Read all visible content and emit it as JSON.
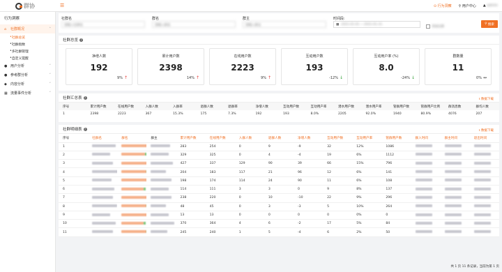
{
  "header": {
    "logo_text": "群协",
    "menu_icon": "hamburger-icon",
    "links": [
      "行为洞察",
      "用户中心"
    ],
    "user_name": "admin"
  },
  "sidebar": {
    "title": "行为洞察",
    "groups": [
      {
        "label": "社群概况",
        "icon": "home-icon",
        "active": true,
        "children": [
          {
            "label": "社群总览",
            "active": true
          },
          {
            "label": "社群指数",
            "active": false
          },
          {
            "label": "多社群管理",
            "active": false
          },
          {
            "label": "自定义提醒",
            "active": false
          }
        ]
      },
      {
        "label": "用户分析",
        "icon": "user-icon",
        "active": false
      },
      {
        "label": "参考群分析",
        "icon": "users-icon",
        "active": false
      },
      {
        "label": "内容分析",
        "icon": "content-icon",
        "active": false
      },
      {
        "label": "流量事件分析",
        "icon": "chart-icon",
        "active": false
      }
    ]
  },
  "filter": {
    "labels": [
      "社群名",
      "群名",
      "群主",
      "时间段:"
    ],
    "placeholders": [
      "请输入社群名",
      "请输入群名",
      "请输入群主",
      ""
    ],
    "date_value": "2021-01-01 ~ 2021-01-31",
    "checkbox_label": "添加比群",
    "search_label": "搜索"
  },
  "overview": {
    "title": "社群总览",
    "cards": [
      {
        "title": "净增人数",
        "value": "192",
        "change": "9%",
        "dir": "up"
      },
      {
        "title": "累计用户数",
        "value": "2398",
        "change": "14%",
        "dir": "up"
      },
      {
        "title": "在线用户数",
        "value": "2223",
        "change": "9%",
        "dir": "up"
      },
      {
        "title": "互动用户数",
        "value": "193",
        "change": "-12%",
        "dir": "down"
      },
      {
        "title": "互动用户率 (%)",
        "value": "8.0",
        "change": "-24%",
        "dir": "down"
      },
      {
        "title": "群数量",
        "value": "11",
        "change": "0%",
        "dir": "flat"
      }
    ]
  },
  "summary": {
    "title": "社群汇总表",
    "download": "数据下载",
    "headers": [
      "序号",
      "累计用户数",
      "在线用户数",
      "入群人数",
      "入群率",
      "退群人数",
      "退群率",
      "净增人数",
      "互动用户数",
      "互动用户率",
      "潜水用户数",
      "潜水用户率",
      "管群用户数",
      "管群用户比例",
      "群消息数",
      "群均人数"
    ],
    "row": [
      "1",
      "2398",
      "2223",
      "367",
      "15.3%",
      "175",
      "7.3%",
      "192",
      "193",
      "8.0%",
      "2205",
      "92.0%",
      "1940",
      "80.9%",
      "4076",
      "207"
    ]
  },
  "detail": {
    "title": "社群明细表",
    "download": "数据下载",
    "headers": [
      "序号",
      "社群名",
      "群名",
      "群主",
      "累计用户数",
      "在线用户数",
      "入群人数",
      "退群人数",
      "净增人数",
      "互动用户数",
      "互动用户率",
      "管群用户数",
      "群入时间",
      "群主时间",
      "退出时间"
    ],
    "rows": [
      [
        "1",
        "283",
        "254",
        "0",
        "9",
        "-9",
        "32",
        "12%",
        "1086"
      ],
      [
        "2",
        "329",
        "325",
        "0",
        "4",
        "-4",
        "19",
        "6%",
        "1112"
      ],
      [
        "3",
        "427",
        "337",
        "129",
        "90",
        "39",
        "66",
        "15%",
        "796"
      ],
      [
        "4",
        "204",
        "183",
        "117",
        "21",
        "96",
        "12",
        "6%",
        "141"
      ],
      [
        "5",
        "198",
        "174",
        "114",
        "24",
        "90",
        "11",
        "6%",
        "108"
      ],
      [
        "6",
        "114",
        "111",
        "3",
        "3",
        "0",
        "9",
        "8%",
        "137"
      ],
      [
        "7",
        "238",
        "220",
        "0",
        "10",
        "-10",
        "22",
        "9%",
        "296"
      ],
      [
        "8",
        "48",
        "45",
        "0",
        "3",
        "-3",
        "5",
        "10%",
        "264"
      ],
      [
        "9",
        "13",
        "13",
        "0",
        "0",
        "0",
        "0",
        "0%",
        "0"
      ],
      [
        "10",
        "370",
        "364",
        "4",
        "6",
        "-2",
        "17",
        "5%",
        "84"
      ],
      [
        "11",
        "245",
        "240",
        "1",
        "5",
        "-4",
        "6",
        "2%",
        "50"
      ]
    ]
  },
  "footer": "共 1 页 11 条记录，当前为第 1 页"
}
